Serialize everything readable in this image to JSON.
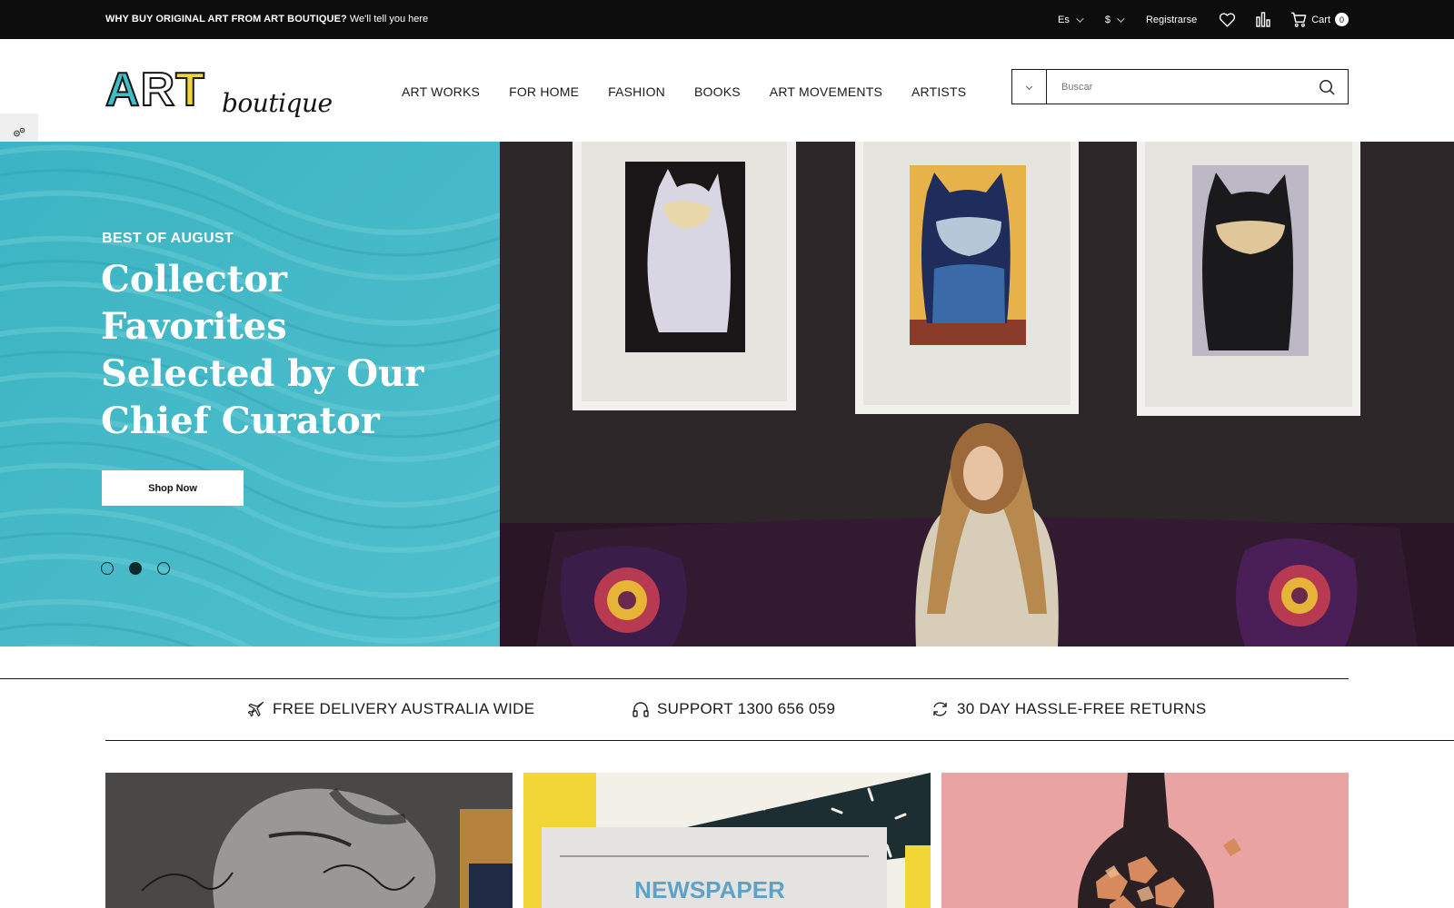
{
  "topbar": {
    "promo_bold": "WHY BUY ORIGINAL ART FROM ART BOUTIQUE?",
    "promo_text": "We'll tell you here",
    "language": "Es",
    "currency": "$",
    "register": "Registrarse",
    "cart_label": "Cart",
    "cart_count": "0"
  },
  "logo": {
    "art": [
      "A",
      "R",
      "T"
    ],
    "script": "boutique"
  },
  "nav": {
    "items": [
      "ART WORKS",
      "FOR HOME",
      "FASHION",
      "BOOKS",
      "ART MOVEMENTS",
      "ARTISTS"
    ]
  },
  "search": {
    "placeholder": "Buscar"
  },
  "hero": {
    "eyebrow": "BEST OF AUGUST",
    "title": "Collector Favorites Selected by Our Chief Curator",
    "button": "Shop Now",
    "slides": 3,
    "active_slide": 2
  },
  "features": {
    "items": [
      {
        "icon": "plane-icon",
        "label": "FREE DELIVERY AUSTRALIA WIDE"
      },
      {
        "icon": "headset-icon",
        "label": "SUPPORT 1300 656 059"
      },
      {
        "icon": "refresh-icon",
        "label": "30 DAY HASSLE-FREE RETURNS"
      }
    ]
  },
  "cards": {
    "card2_text": "NEWSPAPER"
  },
  "colors": {
    "topbar_bg": "#0d0d0d",
    "hero_teal": "#3db2c2",
    "logo_teal": "#3cc0c5",
    "logo_yellow": "#f2d43a"
  }
}
